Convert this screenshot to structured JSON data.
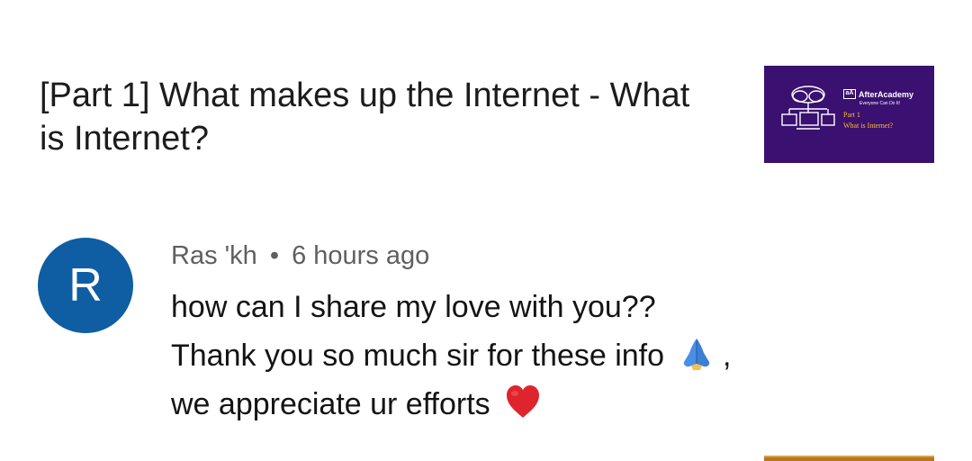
{
  "video": {
    "title": "[Part 1] What makes up the Internet - What is Internet?",
    "thumbnail": {
      "logo_text": "aA",
      "brand": "AfterAcademy",
      "tagline": "Everyone Can Do It!",
      "part": "Part 1",
      "subtitle": "What is Internet?",
      "background_color": "#3a1070",
      "accent_color": "#ffbf2e"
    }
  },
  "comment": {
    "avatar_letter": "R",
    "avatar_color": "#0f5ea3",
    "author": "Ras 'kh",
    "separator": "•",
    "time": "6 hours ago",
    "lines": [
      "how can I share my love with you??",
      "Thank you so much sir for these info",
      "we appreciate ur efforts"
    ],
    "line2_suffix": ",",
    "icons": [
      "folded-hands-icon",
      "red-heart-icon"
    ]
  }
}
